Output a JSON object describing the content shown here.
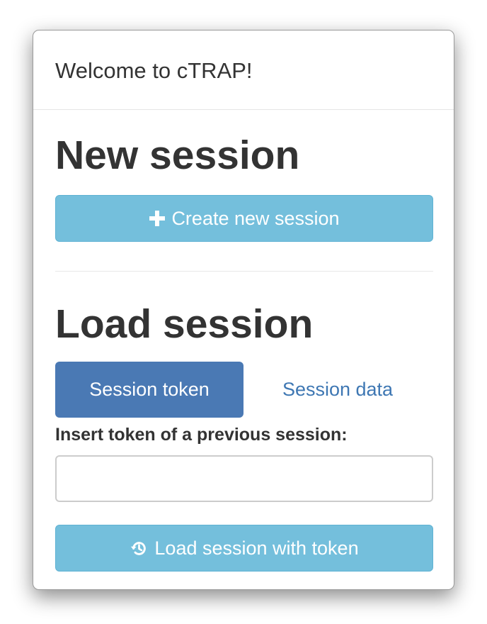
{
  "modal": {
    "title": "Welcome to cTRAP!"
  },
  "new_session": {
    "heading": "New session",
    "button_label": "Create new session",
    "button_icon": "plus-icon"
  },
  "load_session": {
    "heading": "Load session",
    "tabs": [
      {
        "label": "Session token",
        "active": true
      },
      {
        "label": "Session data",
        "active": false
      }
    ],
    "token_label": "Insert token of a previous session:",
    "token_value": "",
    "token_placeholder": "",
    "button_label": "Load session with token",
    "button_icon": "history-icon"
  },
  "colors": {
    "info_button": "#74bfdc",
    "active_tab": "#4a79b4",
    "link_text": "#3e77b3",
    "heading_text": "#333333"
  }
}
